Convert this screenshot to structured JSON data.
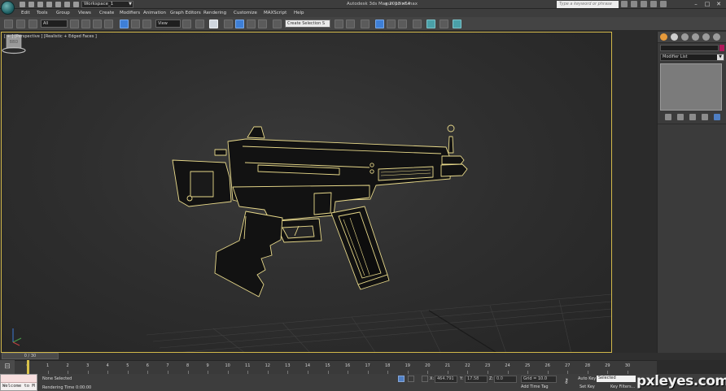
{
  "title_bar": {
    "workspace": "Workspace_1",
    "app_title": "Autodesk 3ds Max 2013 x64",
    "file_name": "gun point.max",
    "search_placeholder": "Type a keyword or phrase"
  },
  "menu": [
    "Edit",
    "Tools",
    "Group",
    "Views",
    "Create",
    "Modifiers",
    "Animation",
    "Graph Editors",
    "Rendering",
    "Customize",
    "MAXScript",
    "Help"
  ],
  "toolbar": {
    "selection_filter": "All",
    "ref_coord": "View",
    "named_selection": "Create Selection S"
  },
  "viewport": {
    "label": "[ + ] [Perspective ] [Realistic + Edged Faces ]",
    "viewcube_label": "BBD"
  },
  "command_panel": {
    "modifier_list": "Modifier List"
  },
  "timeline": {
    "time_slider": "0 / 30",
    "ticks": [
      "0",
      "1",
      "2",
      "3",
      "4",
      "5",
      "6",
      "7",
      "8",
      "9",
      "10",
      "11",
      "12",
      "13",
      "14",
      "15",
      "16",
      "17",
      "18",
      "19",
      "20",
      "21",
      "22",
      "23",
      "24",
      "25",
      "26",
      "27",
      "28",
      "29",
      "30"
    ]
  },
  "status": {
    "maxscript": "Welcome to M",
    "selection": "None Selected",
    "rendering_time": "Rendering Time 0:00:00",
    "x_label": "X:",
    "x_value": "464.791",
    "y_label": "Y:",
    "y_value": "17.58",
    "z_label": "Z:",
    "z_value": "0.0",
    "grid": "Grid = 10.0",
    "add_time_tag": "Add Time Tag",
    "auto_key": "Auto Key",
    "set_key": "Set Key",
    "selected_dropdown": "Selected",
    "key_filters": "Key Filters..."
  },
  "watermark": "pxleyes.com",
  "colors": {
    "viewport_border": "#d2b84a",
    "wire": "#e8d98a",
    "accent_blue": "#3e7fd6",
    "object_color_swatch": "#b0185a"
  }
}
